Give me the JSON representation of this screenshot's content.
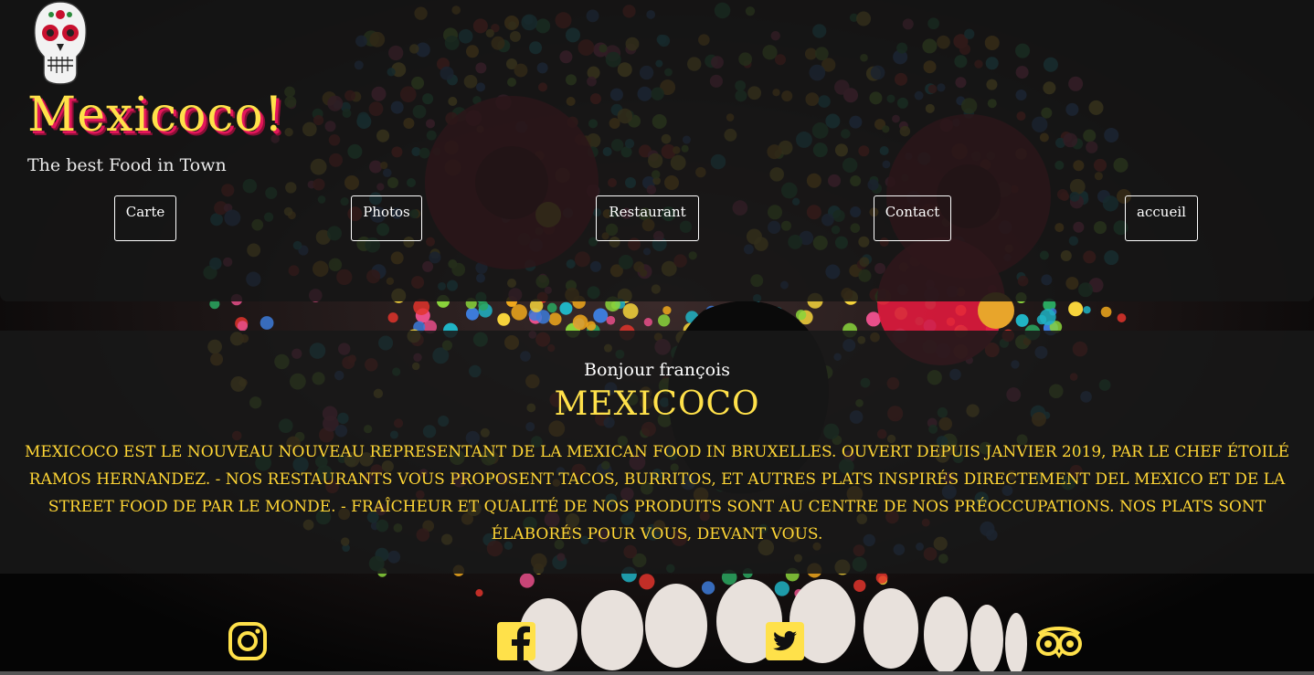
{
  "header": {
    "brand": "Mexicoco!",
    "tagline": "The best Food in Town"
  },
  "nav": {
    "items": [
      {
        "label": "Carte"
      },
      {
        "label": "Photos"
      },
      {
        "label": "Restaurant"
      },
      {
        "label": "Contact"
      },
      {
        "label": "accueil"
      }
    ]
  },
  "main": {
    "greeting": "Bonjour françois",
    "title": "MEXICOCO",
    "description": "Mexicoco est le nouveau nouveau representant de la Mexican food in Bruxelles. Ouvert depuis janvier 2019, par le chef étoilé Ramos Hernandez. - Nos restaurants vous proposent tacos, burritos, et autres plats inspirés directement del Mexico et de la street food de par le monde. - Fraîcheur et qualité de nos produits sont au centre de nos préoccupations. Nos plats sont élaborés pour vous, devant vous."
  },
  "social": [
    {
      "icon": "instagram-icon"
    },
    {
      "icon": "facebook-icon"
    },
    {
      "icon": "twitter-icon"
    },
    {
      "icon": "tripadvisor-icon"
    }
  ],
  "colors": {
    "accent": "#ffe14a",
    "brand_shadow": "#e3165b",
    "panel": "#181818"
  }
}
